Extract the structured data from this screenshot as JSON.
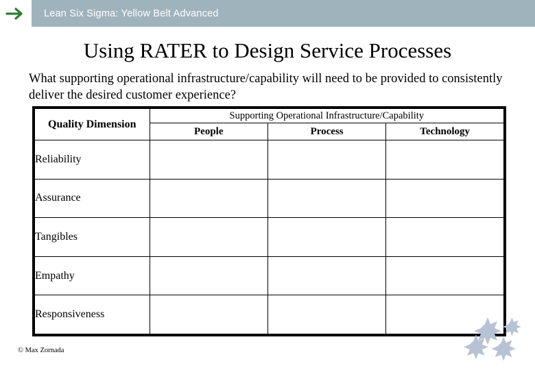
{
  "header": {
    "logo_icon": "arrow-right-icon",
    "title": "Lean Six Sigma: Yellow Belt Advanced"
  },
  "slide": {
    "title": "Using RATER to Design Service Processes",
    "question": "What supporting operational infrastructure/capability will need to be provided to consistently deliver the desired customer experience?"
  },
  "table": {
    "quality_header": "Quality Dimension",
    "group_header": "Supporting Operational Infrastructure/Capability",
    "columns": [
      "People",
      "Process",
      "Technology"
    ],
    "rows": [
      {
        "dimension": "Reliability",
        "people": "",
        "process": "",
        "technology": ""
      },
      {
        "dimension": "Assurance",
        "people": "",
        "process": "",
        "technology": ""
      },
      {
        "dimension": "Tangibles",
        "people": "",
        "process": "",
        "technology": ""
      },
      {
        "dimension": "Empathy",
        "people": "",
        "process": "",
        "technology": ""
      },
      {
        "dimension": "Responsiveness",
        "people": "",
        "process": "",
        "technology": ""
      }
    ]
  },
  "footer": {
    "copyright": "© Max Zornada"
  },
  "colors": {
    "header_bar": "#9fb3bd",
    "header_text": "#ffffff",
    "logo_arrow": "#2e7d32",
    "star": "#b7c3d4",
    "table_border": "#000000"
  },
  "decorations": {
    "stars_icon": "stars-cluster-icon"
  }
}
